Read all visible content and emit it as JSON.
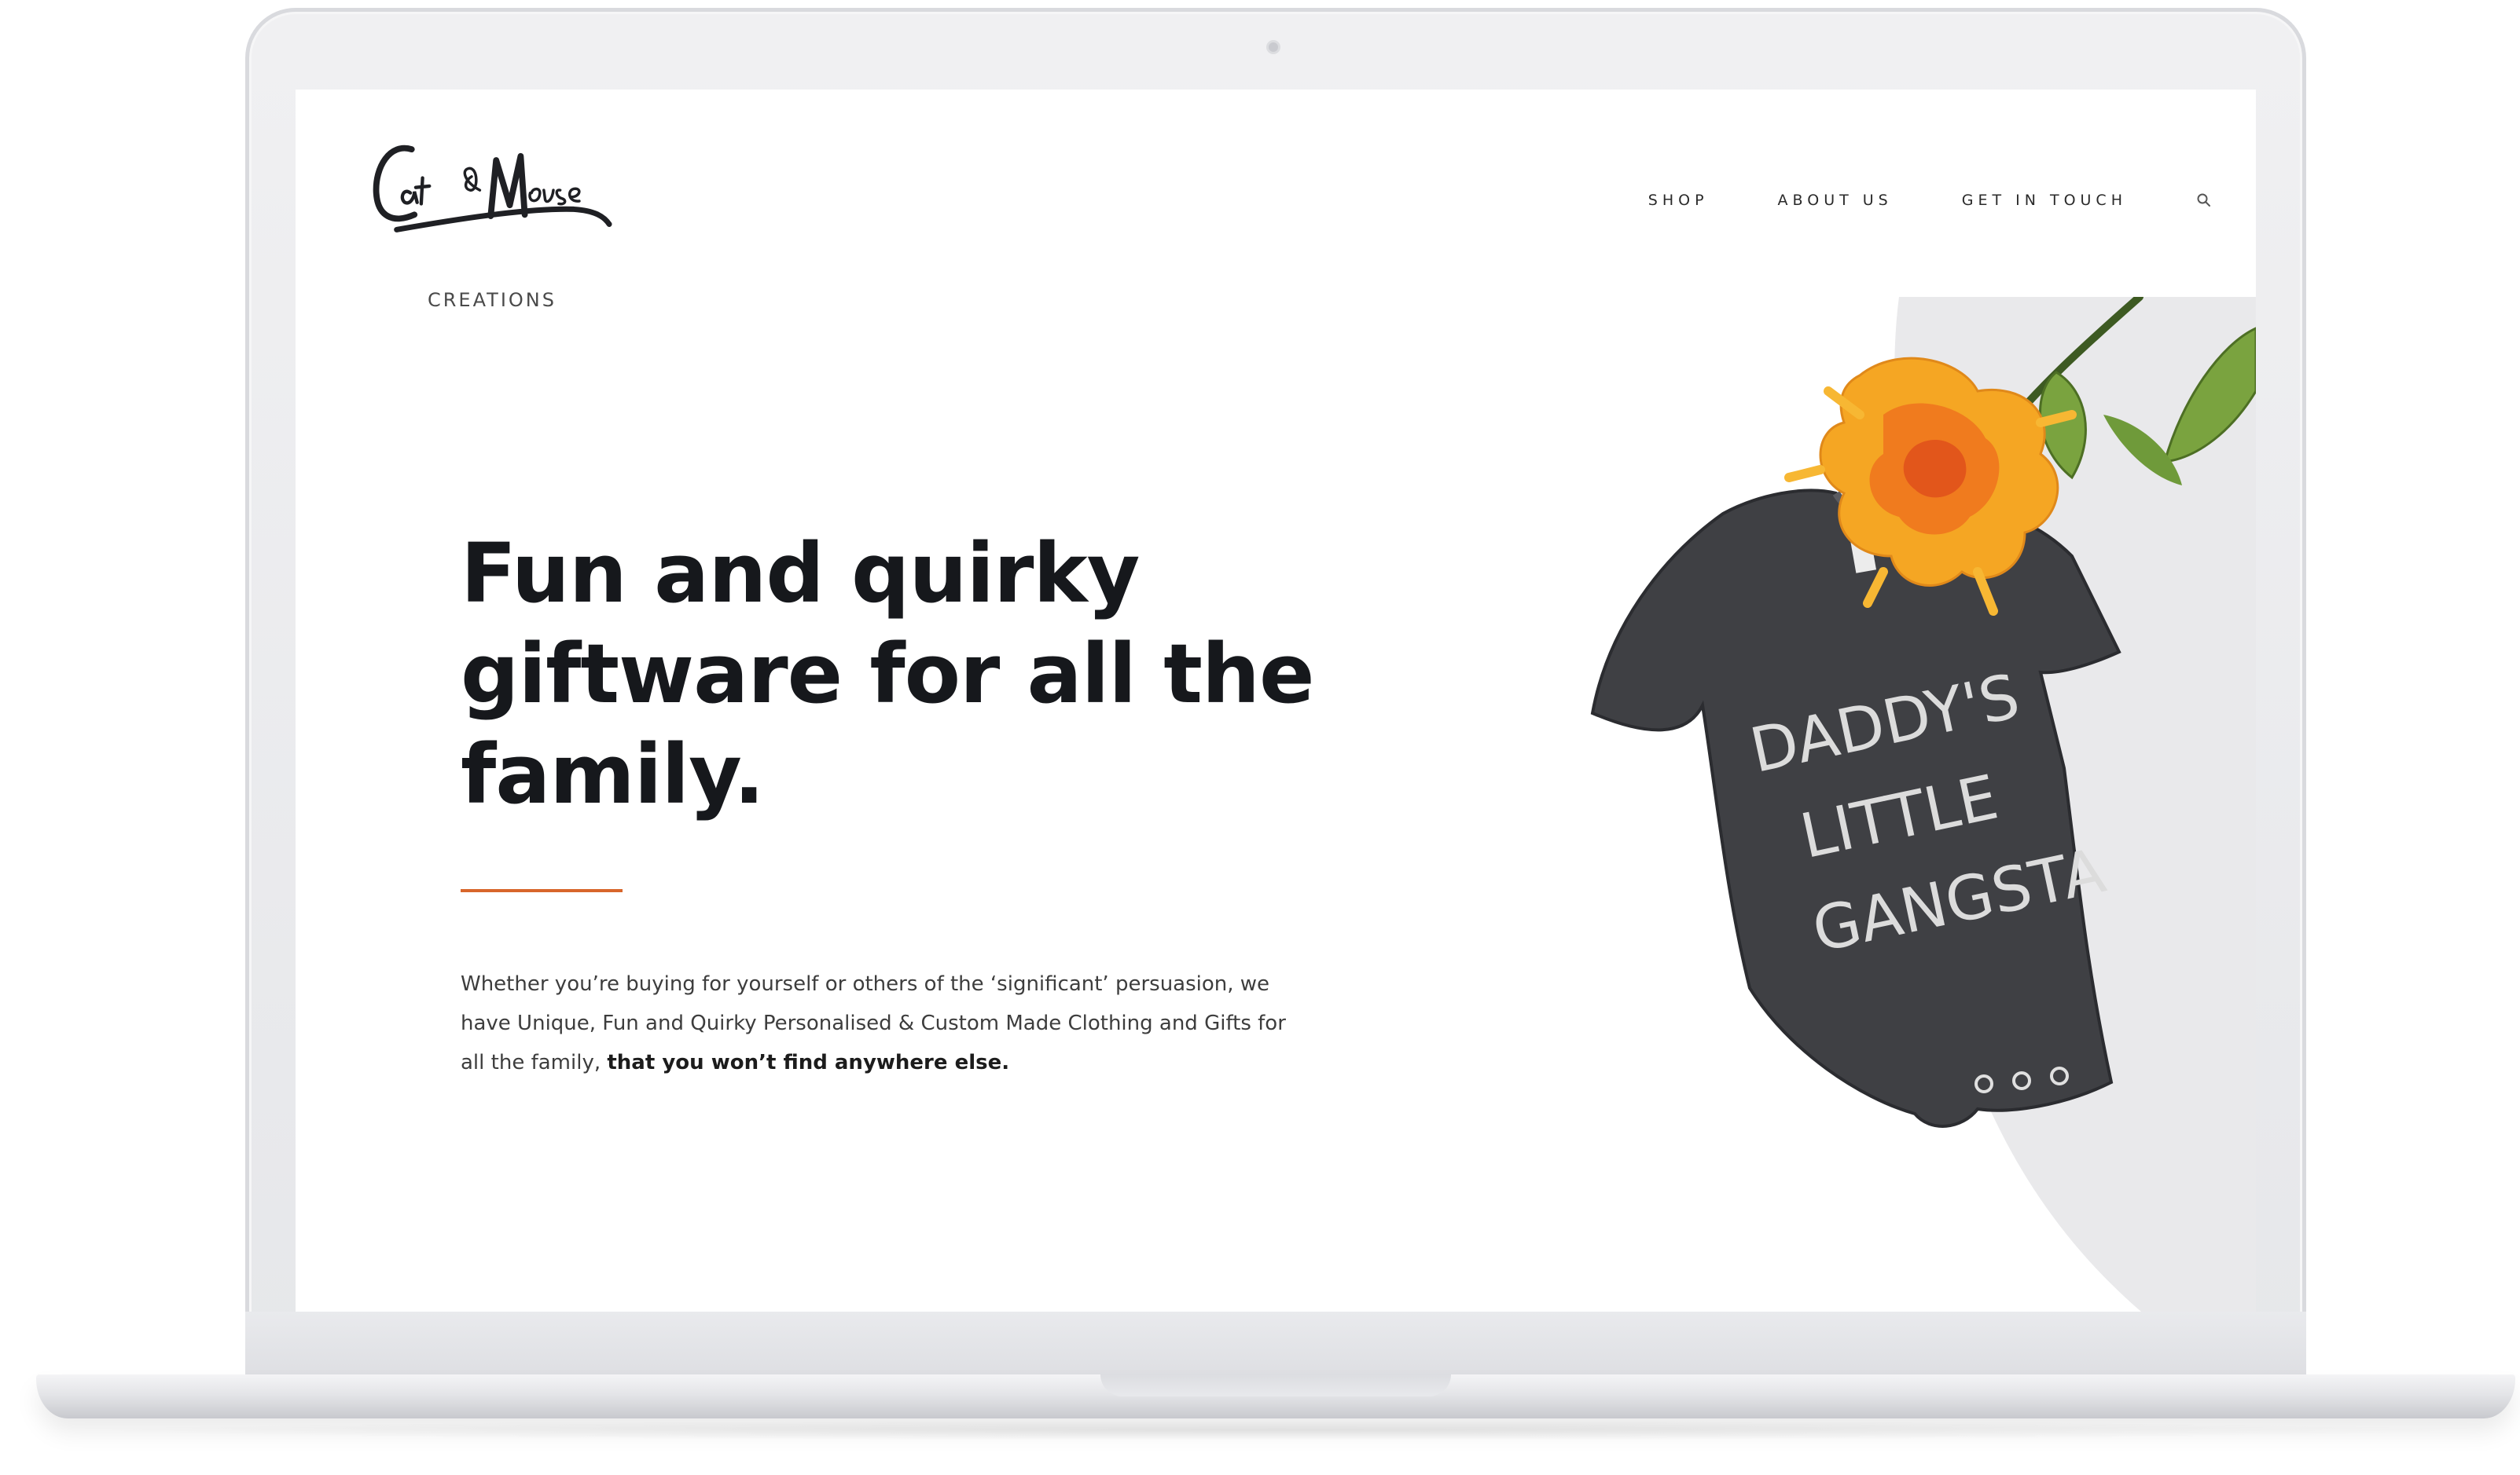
{
  "site": {
    "logo": {
      "script_text": "Cat & Mouse",
      "subtitle": "CREATIONS"
    },
    "nav": {
      "items": [
        {
          "label": "SHOP"
        },
        {
          "label": "ABOUT US"
        },
        {
          "label": "GET IN TOUCH"
        }
      ],
      "search_icon": "search-icon"
    },
    "hero": {
      "headline": "Fun and quirky giftware for all the family.",
      "body_regular": "Whether you’re buying for yourself or others of the ‘significant’ persuasion, we have Unique, Fun and Quirky Personalised & Custom Made Clothing and Gifts for all the family, ",
      "body_bold": "that you won’t find anywhere else.",
      "accent_color": "#d8662b",
      "image": {
        "onesie_print": [
          "DADDY'S",
          "LITTLE",
          "GANGSTA"
        ]
      }
    }
  },
  "colors": {
    "headline": "#16181c",
    "body": "#3d3d3d",
    "background_shape": "#e9e9eb",
    "onesie": "#3f4044",
    "flower": "#f39a1e",
    "leaf": "#6f9a3a"
  }
}
